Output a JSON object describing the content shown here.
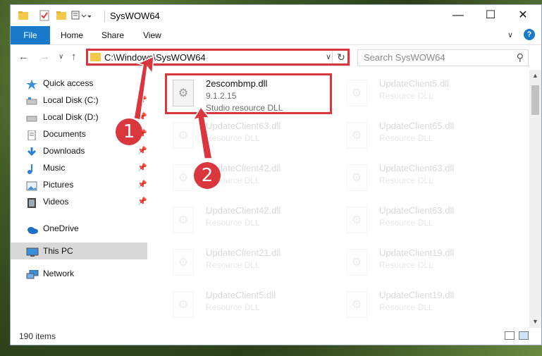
{
  "window": {
    "title": "SysWOW64",
    "controls": {
      "minimize": "—",
      "maximize": "☐",
      "close": "✕"
    }
  },
  "ribbon": {
    "tabs": [
      "File",
      "Home",
      "Share",
      "View"
    ],
    "help": "?"
  },
  "nav": {
    "address": "C:\\Windows\\SysWOW64",
    "search_placeholder": "Search SysWOW64"
  },
  "sidebar": {
    "items": [
      {
        "label": "Quick access",
        "icon": "star-icon",
        "pinned": false
      },
      {
        "label": "Local Disk (C:)",
        "icon": "drive-icon",
        "pinned": true
      },
      {
        "label": "Local Disk (D:)",
        "icon": "drive-icon",
        "pinned": true
      },
      {
        "label": "Documents",
        "icon": "documents-icon",
        "pinned": true
      },
      {
        "label": "Downloads",
        "icon": "download-icon",
        "pinned": true
      },
      {
        "label": "Music",
        "icon": "music-icon",
        "pinned": true
      },
      {
        "label": "Pictures",
        "icon": "pictures-icon",
        "pinned": true
      },
      {
        "label": "Videos",
        "icon": "videos-icon",
        "pinned": true
      },
      {
        "label": "OneDrive",
        "icon": "cloud-icon",
        "pinned": false
      },
      {
        "label": "This PC",
        "icon": "computer-icon",
        "pinned": false,
        "selected": true
      },
      {
        "label": "Network",
        "icon": "network-icon",
        "pinned": false
      }
    ]
  },
  "files": [
    {
      "name": "2escombmp.dll",
      "version": "9.1.2.15",
      "type": "Studio resource DLL",
      "highlighted": true
    },
    {
      "name": "UpdateClient5.dll",
      "type": "Resource DLL"
    },
    {
      "name": "UpdateClient63.dll",
      "type": "Resource DLL"
    },
    {
      "name": "UpdateClient65.dll",
      "type": "Resource DLL"
    },
    {
      "name": "UpdateClient42.dll",
      "type": "Resource DLL"
    },
    {
      "name": "UpdateClient63.dll",
      "type": "Resource DLL"
    },
    {
      "name": "UpdateClient42.dll",
      "type": "Resource DLL"
    },
    {
      "name": "UpdateClient63.dll",
      "type": "Resource DLL"
    },
    {
      "name": "UpdateClient21.dll",
      "type": "Resource DLL"
    },
    {
      "name": "UpdateClient19.dll",
      "type": "Resource DLL"
    },
    {
      "name": "UpdateClient5.dll",
      "type": "Resource DLL"
    },
    {
      "name": "UpdateClient19.dll",
      "type": "Resource DLL"
    }
  ],
  "status": {
    "count": "190 items"
  },
  "annotations": {
    "step1": "1",
    "step2": "2",
    "color": "#d9363e"
  }
}
